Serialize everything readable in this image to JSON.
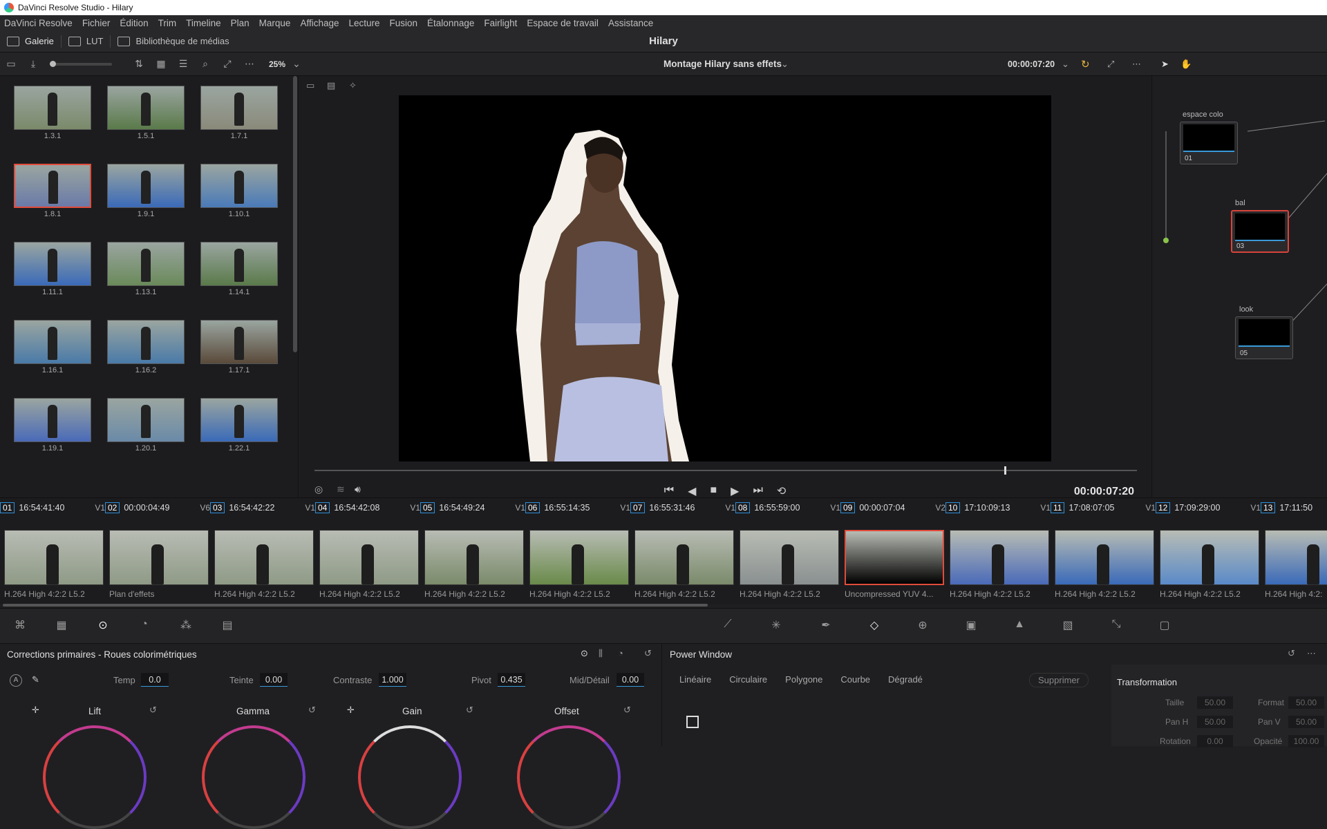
{
  "window": {
    "title": "DaVinci Resolve Studio - Hilary"
  },
  "menu": [
    "DaVinci Resolve",
    "Fichier",
    "Édition",
    "Trim",
    "Timeline",
    "Plan",
    "Marque",
    "Affichage",
    "Lecture",
    "Fusion",
    "Étalonnage",
    "Fairlight",
    "Espace de travail",
    "Assistance"
  ],
  "toolbar": {
    "gallery": "Galerie",
    "lut": "LUT",
    "media": "Bibliothèque de médias",
    "project": "Hilary"
  },
  "viewer": {
    "zoom": "25%",
    "clip_name": "Montage Hilary sans effets",
    "timecode": "00:00:07:20",
    "timecode_big": "00:00:07:20"
  },
  "gallery": {
    "stills": [
      "1.3.1",
      "1.5.1",
      "1.7.1",
      "1.8.1",
      "1.9.1",
      "1.10.1",
      "1.11.1",
      "1.13.1",
      "1.14.1",
      "1.16.1",
      "1.16.2",
      "1.17.1",
      "1.19.1",
      "1.20.1",
      "1.22.1"
    ]
  },
  "nodes": [
    {
      "label": "espace colo",
      "num": "01"
    },
    {
      "label": "bal",
      "num": "03"
    },
    {
      "label": "look",
      "num": "05"
    }
  ],
  "clips": [
    {
      "num": "01",
      "tc": "16:54:41:40",
      "track": "V1",
      "codec": "H.264 High 4:2:2 L5.2"
    },
    {
      "num": "02",
      "tc": "00:00:04:49",
      "track": "V6",
      "codec": "Plan d'effets"
    },
    {
      "num": "03",
      "tc": "16:54:42:22",
      "track": "V1",
      "codec": "H.264 High 4:2:2 L5.2"
    },
    {
      "num": "04",
      "tc": "16:54:42:08",
      "track": "V1",
      "codec": "H.264 High 4:2:2 L5.2"
    },
    {
      "num": "05",
      "tc": "16:54:49:24",
      "track": "V1",
      "codec": "H.264 High 4:2:2 L5.2"
    },
    {
      "num": "06",
      "tc": "16:55:14:35",
      "track": "V1",
      "codec": "H.264 High 4:2:2 L5.2"
    },
    {
      "num": "07",
      "tc": "16:55:31:46",
      "track": "V1",
      "codec": "H.264 High 4:2:2 L5.2"
    },
    {
      "num": "08",
      "tc": "16:55:59:00",
      "track": "V1",
      "codec": "H.264 High 4:2:2 L5.2"
    },
    {
      "num": "09",
      "tc": "00:00:07:04",
      "track": "V2",
      "codec": "Uncompressed YUV 4..."
    },
    {
      "num": "10",
      "tc": "17:10:09:13",
      "track": "V1",
      "codec": "H.264 High 4:2:2 L5.2"
    },
    {
      "num": "11",
      "tc": "17:08:07:05",
      "track": "V1",
      "codec": "H.264 High 4:2:2 L5.2"
    },
    {
      "num": "12",
      "tc": "17:09:29:00",
      "track": "V1",
      "codec": "H.264 High 4:2:2 L5.2"
    },
    {
      "num": "13",
      "tc": "17:11:50",
      "track": "",
      "codec": "H.264 High 4:2:"
    }
  ],
  "primaries": {
    "title": "Corrections primaires - Roues colorimétriques",
    "temp_label": "Temp",
    "temp": "0.0",
    "tint_label": "Teinte",
    "tint": "0.00",
    "contrast_label": "Contraste",
    "contrast": "1.000",
    "pivot_label": "Pivot",
    "pivot": "0.435",
    "middetail_label": "Mid/Détail",
    "middetail": "0.00",
    "wheels": [
      "Lift",
      "Gamma",
      "Gain",
      "Offset"
    ]
  },
  "powerwindow": {
    "title": "Power Window",
    "tabs": [
      "Linéaire",
      "Circulaire",
      "Polygone",
      "Courbe",
      "Dégradé"
    ],
    "delete": "Supprimer",
    "transform": "Transformation",
    "size_label": "Taille",
    "size": "50.00",
    "format_label": "Format",
    "format": "50.00",
    "panh_label": "Pan H",
    "panh": "50.00",
    "panv_label": "Pan V",
    "panv": "50.00",
    "rotation_label": "Rotation",
    "rotation": "0.00",
    "opacity_label": "Opacité",
    "opacity": "100.00"
  }
}
